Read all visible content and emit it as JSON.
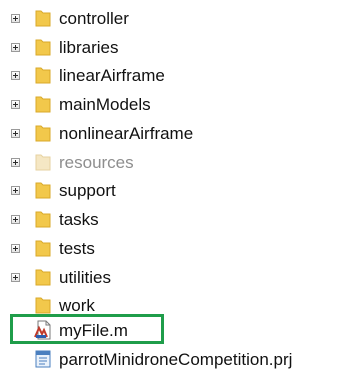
{
  "tree": {
    "items": [
      {
        "label": "controller",
        "type": "folder",
        "expandable": true
      },
      {
        "label": "libraries",
        "type": "folder",
        "expandable": true
      },
      {
        "label": "linearAirframe",
        "type": "folder",
        "expandable": true
      },
      {
        "label": "mainModels",
        "type": "folder",
        "expandable": true
      },
      {
        "label": "nonlinearAirframe",
        "type": "folder",
        "expandable": true
      },
      {
        "label": "resources",
        "type": "folder-dimmed",
        "expandable": true
      },
      {
        "label": "support",
        "type": "folder",
        "expandable": true
      },
      {
        "label": "tasks",
        "type": "folder",
        "expandable": true
      },
      {
        "label": "tests",
        "type": "folder",
        "expandable": true
      },
      {
        "label": "utilities",
        "type": "folder",
        "expandable": true
      },
      {
        "label": "work",
        "type": "folder",
        "expandable": false
      },
      {
        "label": "myFile.m",
        "type": "m-file",
        "expandable": false,
        "highlighted": true
      },
      {
        "label": "parrotMinidroneCompetition.prj",
        "type": "project-file",
        "expandable": false
      }
    ]
  },
  "colors": {
    "folder": "#f2c84b",
    "folder_dimmed": "#f5e7c4",
    "highlight_border": "#1f9d4a"
  }
}
